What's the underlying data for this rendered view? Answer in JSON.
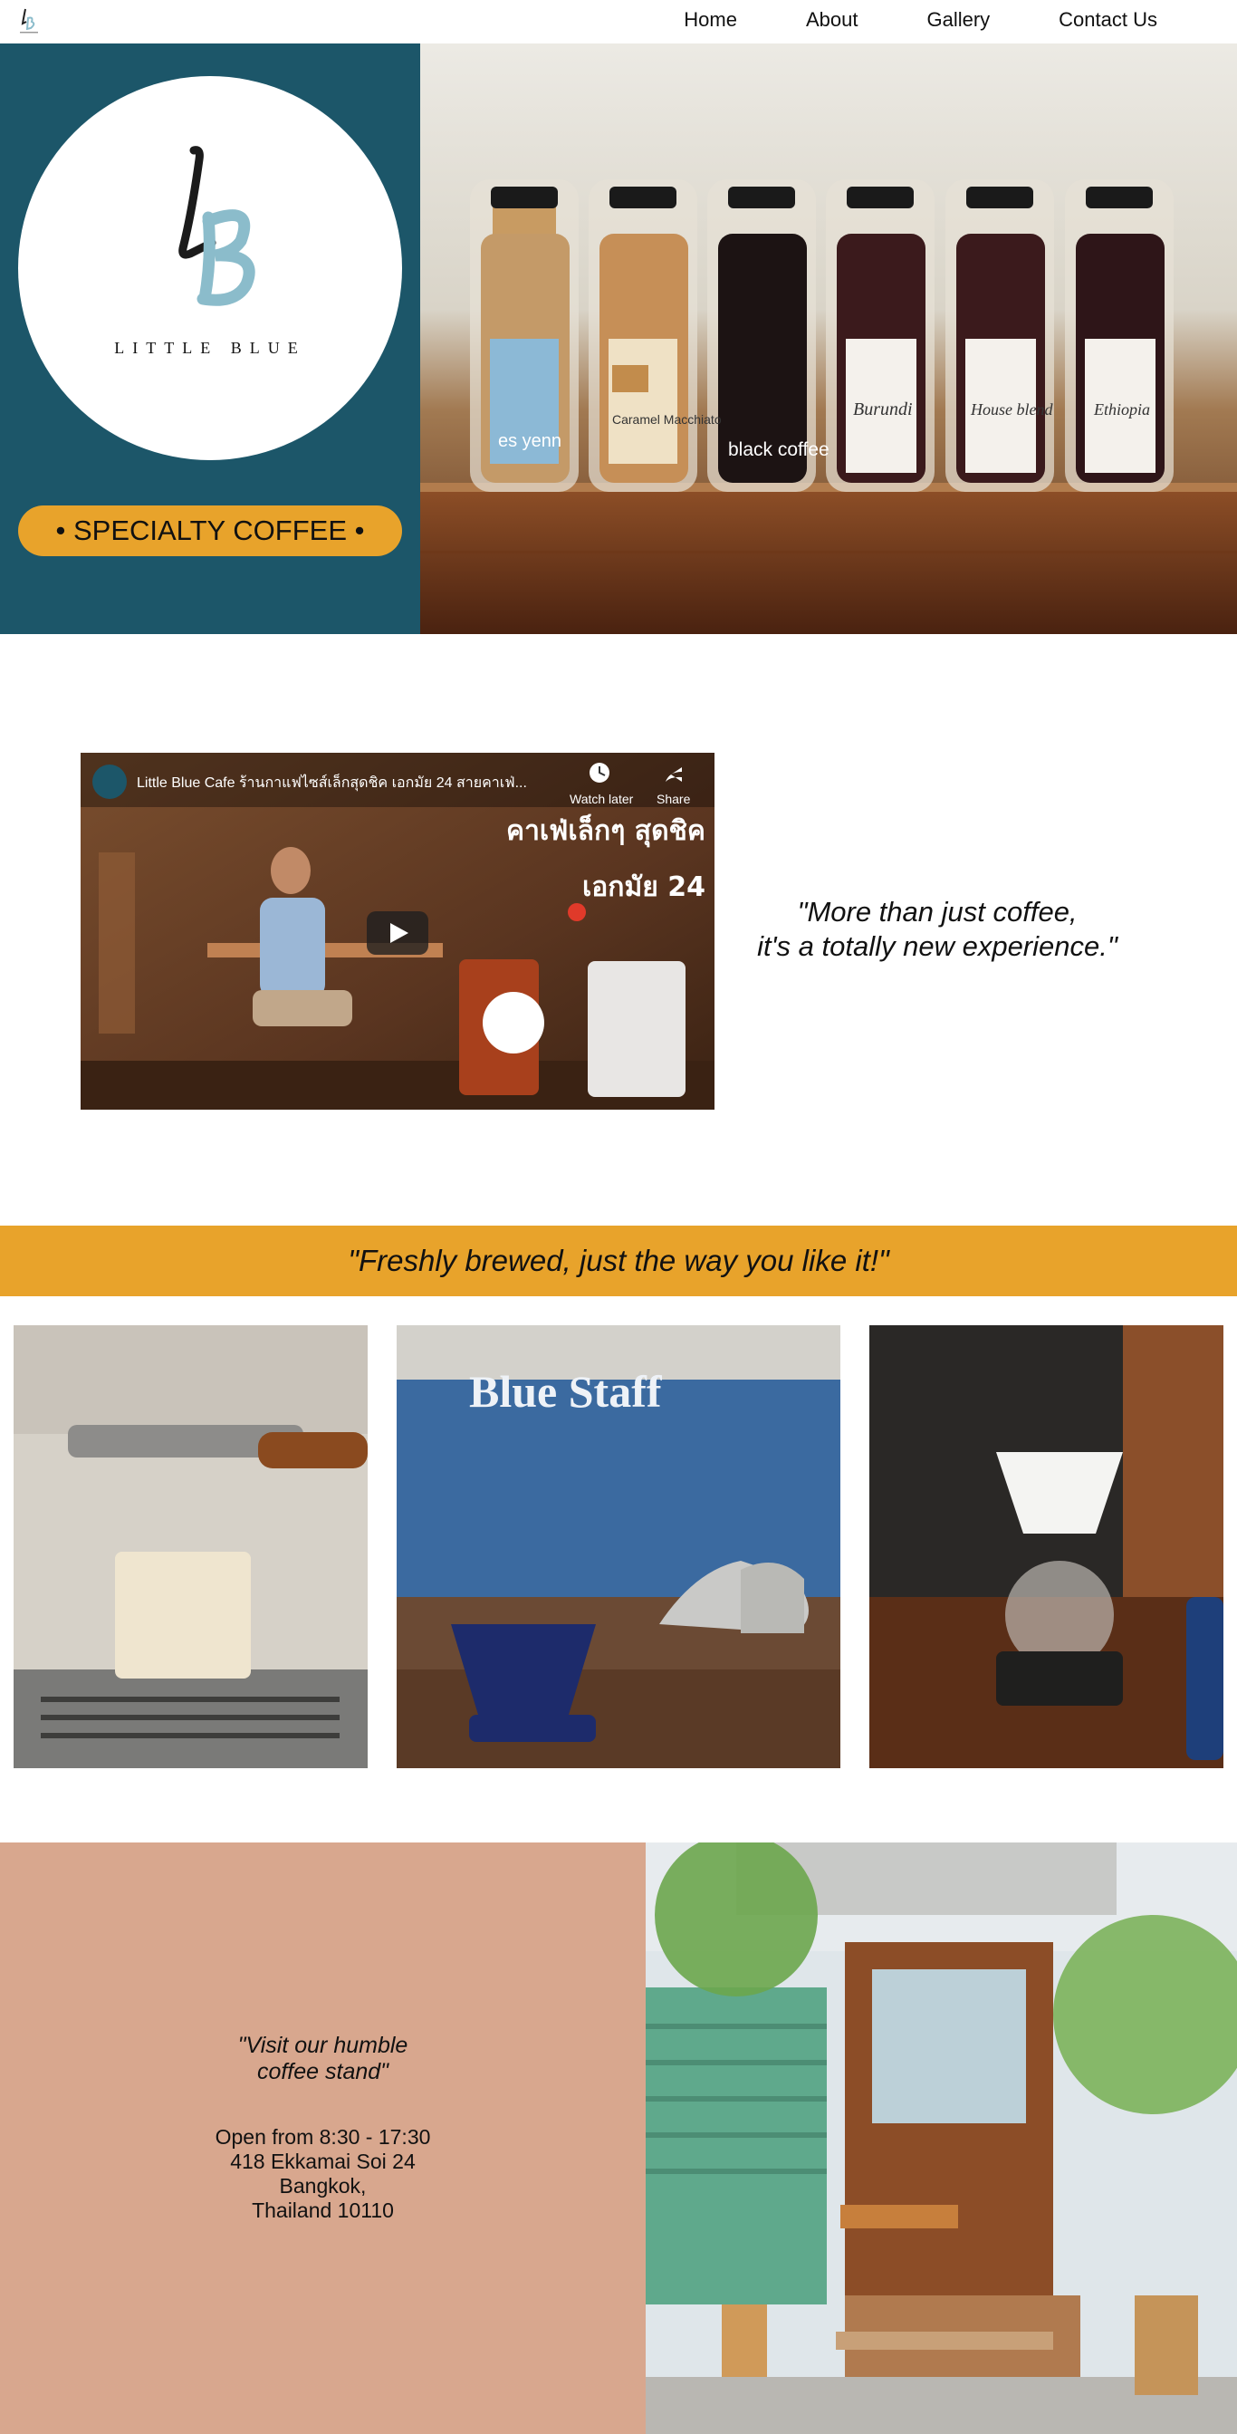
{
  "header": {
    "nav": [
      "Home",
      "About",
      "Gallery",
      "Contact Us"
    ]
  },
  "hero": {
    "brand_monogram": "LB",
    "brand_name": "LITTLE BLUE",
    "tagline": "• SPECIALTY COFFEE •",
    "bottle_labels": [
      "es yenn",
      "Caramel Macchiato",
      "black coffee",
      "Burundi",
      "House blend",
      "Ethiopia"
    ]
  },
  "video": {
    "title": "Little Blue Cafe ร้านกาแฟไซส์เล็กสุดชิค เอกมัย 24 สายคาเฟ่...",
    "watch_later": "Watch later",
    "share": "Share",
    "overlay_line1": "คาเฟ่เล็กๆ สุดชิค",
    "overlay_line2": "เอกมัย 24"
  },
  "quote_main": {
    "line1": "\"More than just coffee,",
    "line2": "it's a totally new experience.\""
  },
  "banner": {
    "text": "\"Freshly brewed, just the way you like it!\""
  },
  "gallery": {
    "shirt_text": "Blue Staff"
  },
  "visit": {
    "quote_line1": "\"Visit our humble",
    "quote_line2": "coffee stand\"",
    "hours": "Open from 8:30 - 17:30",
    "address1": "418 Ekkamai Soi 24",
    "address2": "Bangkok,",
    "address3": "Thailand 10110"
  },
  "colors": {
    "teal": "#1c5669",
    "mustard": "#e8a32b",
    "light_blue": "#8bbccb",
    "peach": "#d8a78e"
  }
}
